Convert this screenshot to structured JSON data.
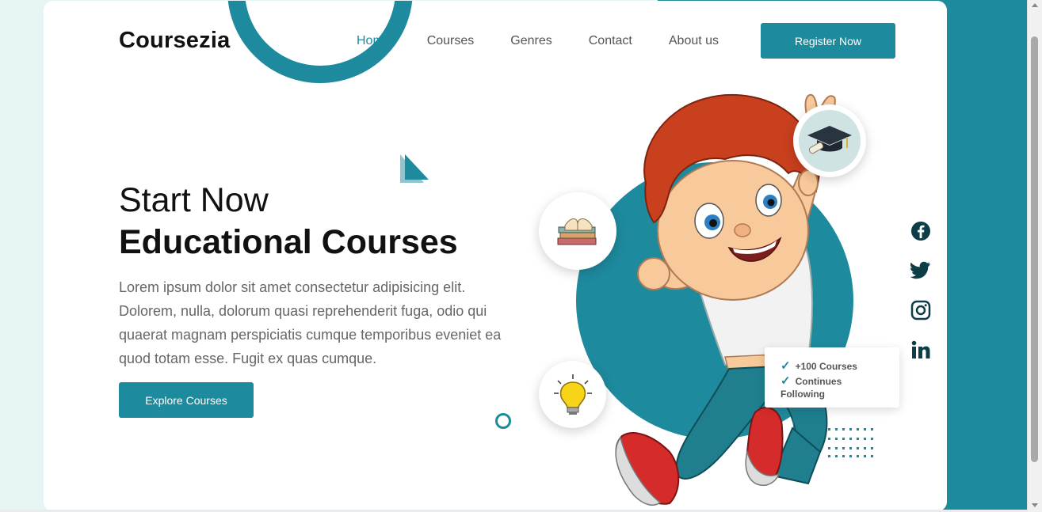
{
  "brand": {
    "name": "Coursezia",
    "accent": "#1e8a9e"
  },
  "nav": {
    "items": [
      {
        "label": "Home",
        "active": true
      },
      {
        "label": "Courses",
        "active": false
      },
      {
        "label": "Genres",
        "active": false
      },
      {
        "label": "Contact",
        "active": false
      },
      {
        "label": "About us",
        "active": false
      }
    ],
    "register_label": "Register Now"
  },
  "hero": {
    "title_light": "Start Now",
    "title_bold": "Educational Courses",
    "description": "Lorem ipsum dolor sit amet consectetur adipisicing elit. Dolorem, nulla, dolorum quasi reprehenderit fuga, odio qui quaerat magnam perspiciatis cumque temporibus eveniet ea quod totam esse. Fugit ex quas cumque.",
    "cta_label": "Explore Courses"
  },
  "info_card": {
    "line1": "+100 Courses",
    "line2": "Continues",
    "line3": "Following"
  },
  "social": [
    "facebook-icon",
    "twitter-icon",
    "instagram-icon",
    "linkedin-icon"
  ]
}
